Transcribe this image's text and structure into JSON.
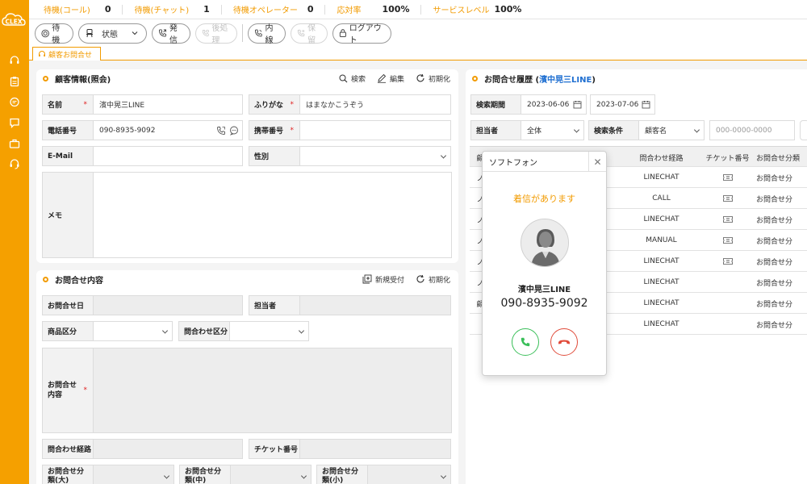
{
  "app": {
    "logo_text": "CLEX"
  },
  "status": [
    {
      "label": "待機(コール)",
      "value": "0"
    },
    {
      "label": "待機(チャット)",
      "value": "1"
    },
    {
      "label": "待機オペレーター",
      "value": "0"
    },
    {
      "label": "応対率",
      "value": "100%"
    },
    {
      "label": "サービスレベル",
      "value": "100%"
    }
  ],
  "toolbar": {
    "standby": "待機",
    "state": "状態",
    "dial": "発信",
    "after_work": "後処理",
    "extension": "内線",
    "hold": "保留",
    "logout": "ログアウト"
  },
  "tab": {
    "label": "顧客お問合せ"
  },
  "customer": {
    "title": "顧客情報(照会)",
    "actions": {
      "search": "検索",
      "edit": "編集",
      "reset": "初期化"
    },
    "name_label": "名前",
    "name_value": "濱中晃三LINE",
    "kana_label": "ふりがな",
    "kana_value": "はまなかこうぞう",
    "phone_label": "電話番号",
    "phone_value": "090-8935-9092",
    "mobile_label": "携帯番号",
    "mobile_value": "",
    "email_label": "E-Mail",
    "email_value": "",
    "gender_label": "性別",
    "gender_value": "",
    "memo_label": "メモ",
    "memo_value": ""
  },
  "inquiry": {
    "title": "お問合せ内容",
    "actions": {
      "new": "新規受付",
      "reset": "初期化"
    },
    "date_label": "お問合せ日",
    "assignee_label": "担当者",
    "product_label": "商品区分",
    "category_label": "問合わせ区分",
    "content_label": "お問合せ内容",
    "route_label": "問合わせ経路",
    "ticket_label": "チケット番号",
    "class_l_label": "お問合せ分類(大)",
    "class_m_label": "お問合せ分類(中)",
    "class_s_label": "お問合せ分類(小)"
  },
  "history": {
    "title_prefix": "お問合せ履歴 (",
    "title_name": "濱中晃三LINE",
    "title_suffix": ")",
    "period_label": "検索期間",
    "date_from": "2023-06-06",
    "date_to": "2023-07-06",
    "assignee_label": "担当者",
    "assignee_value": "全体",
    "condition_label": "検索条件",
    "condition_value": "顧客名",
    "search_placeholder": "000-0000-0000",
    "columns": {
      "first": "顧",
      "route": "問合わせ経路",
      "ticket": "チケット番号",
      "class": "お問合せ分類"
    },
    "rows": [
      {
        "first": "ノ",
        "route": "LINECHAT",
        "ticket": true,
        "class": "お問合せ分"
      },
      {
        "first": "ノ",
        "route": "CALL",
        "ticket": true,
        "class": "お問合せ分"
      },
      {
        "first": "ノ",
        "route": "LINECHAT",
        "ticket": true,
        "class": "お問合せ分"
      },
      {
        "first": "ノ",
        "route": "MANUAL",
        "ticket": true,
        "class": "お問合せ分"
      },
      {
        "first": "ノ",
        "route": "LINECHAT",
        "ticket": true,
        "class": "お問合せ分"
      },
      {
        "first": "ノ",
        "route": "LINECHAT",
        "ticket": false,
        "class": "お問合せ分"
      },
      {
        "first": "顧",
        "route": "LINECHAT",
        "ticket": false,
        "class": "お問合せ分"
      },
      {
        "first": "",
        "route": "LINECHAT",
        "ticket": false,
        "class": "お問合せ分"
      }
    ]
  },
  "softphone": {
    "title": "ソフトフォン",
    "incoming": "着信があります",
    "caller_name": "濱中晃三LINE",
    "caller_number": "090-8935-9092"
  },
  "colors": {
    "accent": "#f29b00",
    "rail": "#f5a000",
    "link": "#1f6fd1",
    "answer": "#3bbf5a",
    "reject": "#e04b3a"
  }
}
